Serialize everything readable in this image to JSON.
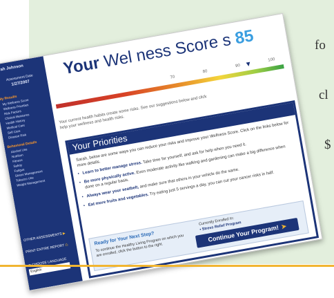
{
  "side_text": [
    "fo",
    "cl",
    "$"
  ],
  "colors": {
    "sidebar": "#1c3478",
    "accent_orange": "#f1b531",
    "page_bg": "#e3efdd",
    "score_blue": "#3a9ee0"
  },
  "sidebar": {
    "user_name": "Sarah Johnson",
    "assessment_label": "Assessment Date",
    "assessment_date": "1/27/2007",
    "results_heading": "My Results",
    "results_items": [
      "My Wellness Score",
      "Wellness Priorities",
      "Risk Factors",
      "Clinical Measures",
      "Health History",
      "Medical Care",
      "Self Care",
      "Disease Risk"
    ],
    "behavioral_heading": "Behavioral Details",
    "behavioral_items": [
      "Alcohol Use",
      "Nutrition",
      "Fitness",
      "Safety",
      "Fatigue",
      "Stress Management",
      "Tobacco Use",
      "Weight Management"
    ],
    "other_assessments": "OTHER ASSESSMENTS",
    "print_report": "PRINT ENTIRE REPORT",
    "choose_language": "CHOOSE LANGUAGE",
    "language_value": "English"
  },
  "main": {
    "title_your": "Your",
    "title_rest": "Wel ness Score",
    "title_s": "s",
    "score": "85",
    "ticks": [
      "70",
      "80",
      "90",
      "100"
    ],
    "explanation": "Your current health habits create some risks. See our suggestions below and click",
    "explanation2": "help your wellness and health risks.",
    "priorities_title": "Your Priorities",
    "priorities_intro": "Sarah, below are some ways you can reduce your risks and improve your Wellness Score. Click on the links below for more details.",
    "priorities": [
      {
        "bold": "Learn to better manage stress.",
        "text": "Take time for yourself, and ask for help when you need it."
      },
      {
        "bold": "Be more physically active.",
        "text": "Even moderate activity like walking and gardening can make a big difference when done on a regular basis."
      },
      {
        "bold": "Always wear your seatbelt,",
        "text": "and make sure that others in your vehicle do the same."
      },
      {
        "bold": "Eat more fruits and vegetables.",
        "text": "Try eating just 5 servings a day, you can cut your cancer risks in half."
      }
    ],
    "next_step_title": "Ready for Your Next Step?",
    "next_step_body": "To continue the Healthy Living Program on which you are enrolled, click the button to the right.",
    "enrolled_label": "Currently Enrolled In:",
    "enrolled_program": "Stress Relief Program",
    "continue_button": "Continue Your Program!"
  }
}
